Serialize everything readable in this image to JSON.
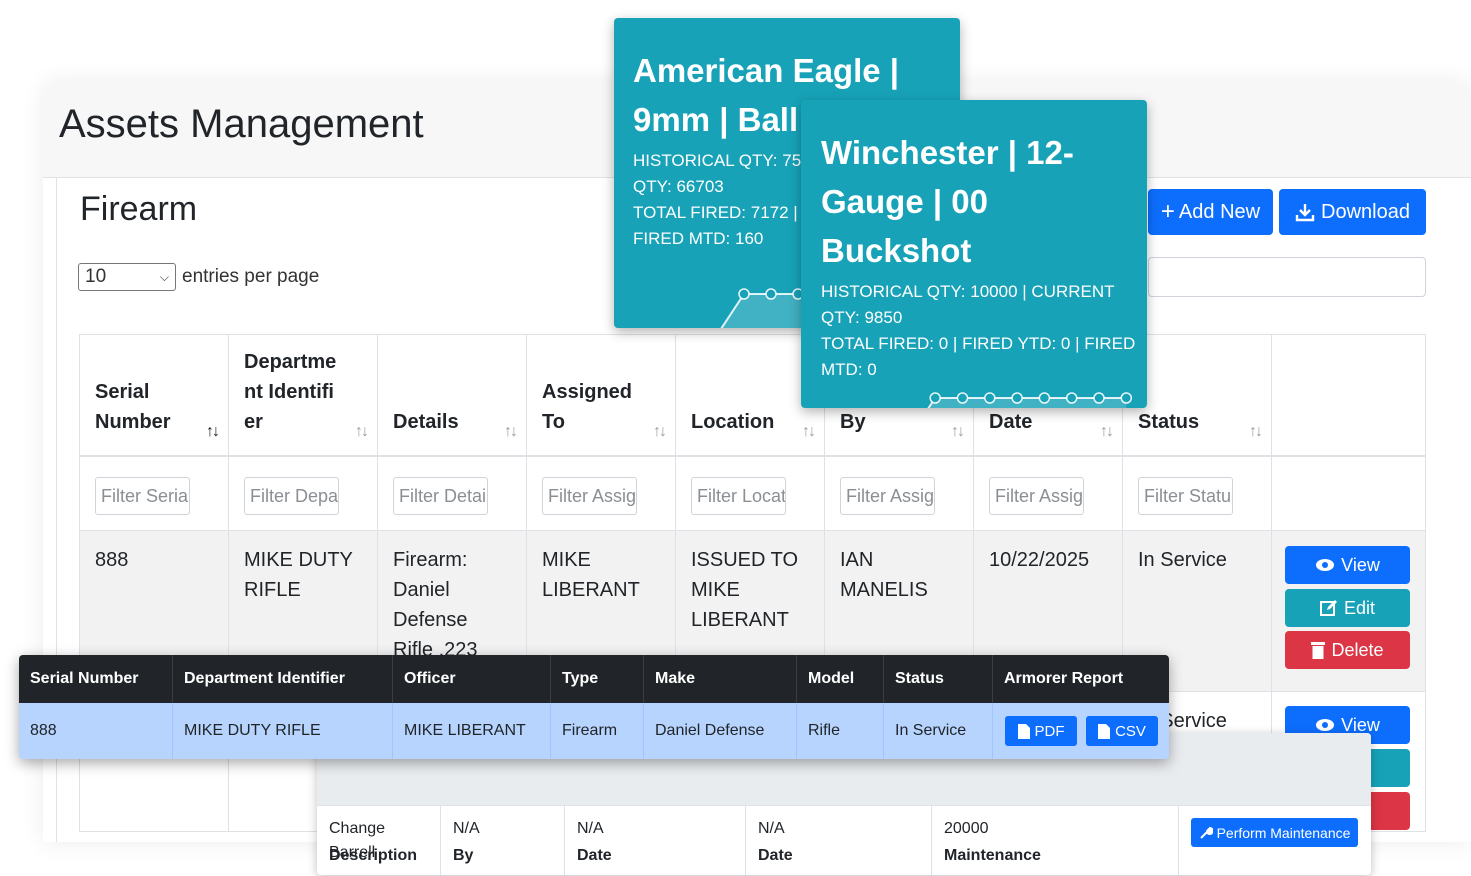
{
  "app": {
    "title": "Assets Management"
  },
  "section": {
    "title": "Firearm"
  },
  "entries": {
    "selected": "10",
    "label": "entries per page"
  },
  "toolbar": {
    "add_new": "Add New",
    "download": "Download"
  },
  "table": {
    "columns": [
      {
        "label": "Serial Number",
        "filter_placeholder": "Filter Seria"
      },
      {
        "label": "Department Identifier",
        "filter_placeholder": "Filter Depa"
      },
      {
        "label": "Details",
        "filter_placeholder": "Filter Detai"
      },
      {
        "label": "Assigned To",
        "filter_placeholder": "Filter Assig"
      },
      {
        "label": "Location",
        "filter_placeholder": "Filter Locat"
      },
      {
        "label": "By",
        "filter_placeholder": "Filter Assig"
      },
      {
        "label": "Date",
        "filter_placeholder": "Filter Assig"
      },
      {
        "label": "Status",
        "filter_placeholder": "Filter Statu"
      }
    ],
    "rows": [
      {
        "serial": "888",
        "department": "MIKE DUTY RIFLE",
        "details": "Firearm: Daniel Defense Rifle .223",
        "assigned_to": "MIKE LIBERANT",
        "location": "ISSUED TO MIKE LIBERANT",
        "by": "IAN MANELIS",
        "date": "10/22/2025",
        "status": "In Service"
      }
    ],
    "row2_status": "In Service",
    "actions": {
      "view": "View",
      "edit": "Edit",
      "delete": "Delete"
    }
  },
  "tooltips": [
    {
      "title": "American Eagle | 9mm | Ball",
      "lines": [
        "HISTORICAL QTY: 750",
        "QTY: 66703",
        "TOTAL FIRED: 7172 | F",
        "FIRED MTD: 160"
      ],
      "sparkline": [
        0,
        0,
        0,
        0,
        1,
        1,
        1,
        1,
        1,
        1,
        1,
        1
      ]
    },
    {
      "title": "Winchester | 12-Gauge | 00 Buckshot",
      "lines": [
        "HISTORICAL QTY: 10000 | CURRENT",
        "QTY: 9850",
        "TOTAL FIRED: 0 | FIRED YTD: 0 | FIRED",
        "MTD: 0"
      ],
      "sparkline": [
        0,
        0,
        0,
        0,
        1,
        1,
        1,
        1,
        1,
        1,
        1,
        1
      ]
    }
  ],
  "armorer": {
    "headers": [
      "Serial Number",
      "Department Identifier",
      "Officer",
      "Type",
      "Make",
      "Model",
      "Status",
      "Armorer Report"
    ],
    "row": [
      "888",
      "MIKE DUTY RIFLE",
      "MIKE LIBERANT",
      "Firearm",
      "Daniel Defense",
      "Rifle",
      "In Service"
    ],
    "pdf": "PDF",
    "csv": "CSV"
  },
  "maintenance": {
    "headers": [
      "Description",
      "By",
      "Date",
      "Date",
      "Maintenance"
    ],
    "row": [
      "Change Barrell",
      "N/A",
      "N/A",
      "N/A",
      "20000"
    ],
    "action": "Perform Maintenance"
  },
  "colors": {
    "primary": "#0d6efd",
    "info": "#17a2b8",
    "danger": "#dc3545",
    "dark": "#212529",
    "row_highlight": "#b6d4fe"
  }
}
